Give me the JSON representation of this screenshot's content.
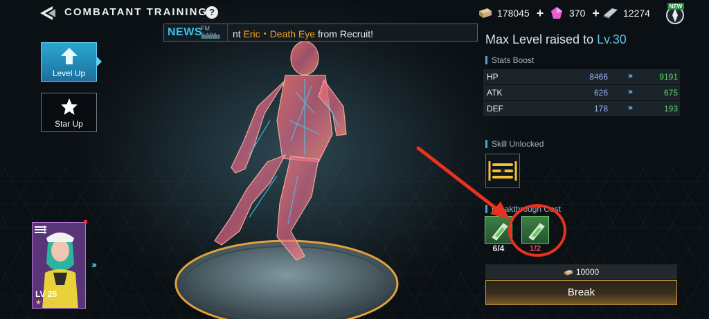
{
  "header": {
    "title": "COMBATANT TRAINING",
    "help": "?",
    "currencies": [
      {
        "icon": "gold-bar-icon",
        "amount": "178045",
        "plus": "+"
      },
      {
        "icon": "pink-gem-icon",
        "amount": "370",
        "plus": "+"
      },
      {
        "icon": "silver-bar-icon",
        "amount": "12274"
      }
    ],
    "new_badge": "NEW"
  },
  "news": {
    "label": "NEWS",
    "frequency": "FM 9.104",
    "bars": "▮▮▮▮▮▮▮▮",
    "message_pre": "nt ",
    "highlight": "Eric・Death Eye",
    "message_post": " from Recruit!"
  },
  "tabs": [
    {
      "label": "Level Up",
      "icon": "arrow-up-icon",
      "active": true
    },
    {
      "label": "Star Up",
      "icon": "star-icon",
      "active": false
    }
  ],
  "character": {
    "level": "LV 25",
    "stars": "★★★"
  },
  "chevrons": "›››",
  "panel": {
    "max_level_text": "Max Level raised to ",
    "max_level_value": "Lv.30",
    "stats_title": "Stats Boost",
    "stats": [
      {
        "name": "HP",
        "old": "8466",
        "arrow": "›››",
        "new": "9191"
      },
      {
        "name": "ATK",
        "old": "626",
        "arrow": "›››",
        "new": "675"
      },
      {
        "name": "DEF",
        "old": "178",
        "arrow": "›››",
        "new": "193"
      }
    ],
    "skill_title": "Skill Unlocked",
    "breakthrough_title": "Breakthrough Cost",
    "costs": [
      {
        "count": "6/4",
        "icon": "green-vial-icon"
      },
      {
        "count": "1/2",
        "icon": "green-vial-icon"
      }
    ],
    "price": "10000",
    "break_label": "Break"
  },
  "colors": {
    "accent_blue": "#5cc6ee",
    "stat_new_green": "#5fd668",
    "insufficient_red": "#e5424a",
    "annotation_red": "#e8321f",
    "highlight_orange": "#f3a321"
  }
}
